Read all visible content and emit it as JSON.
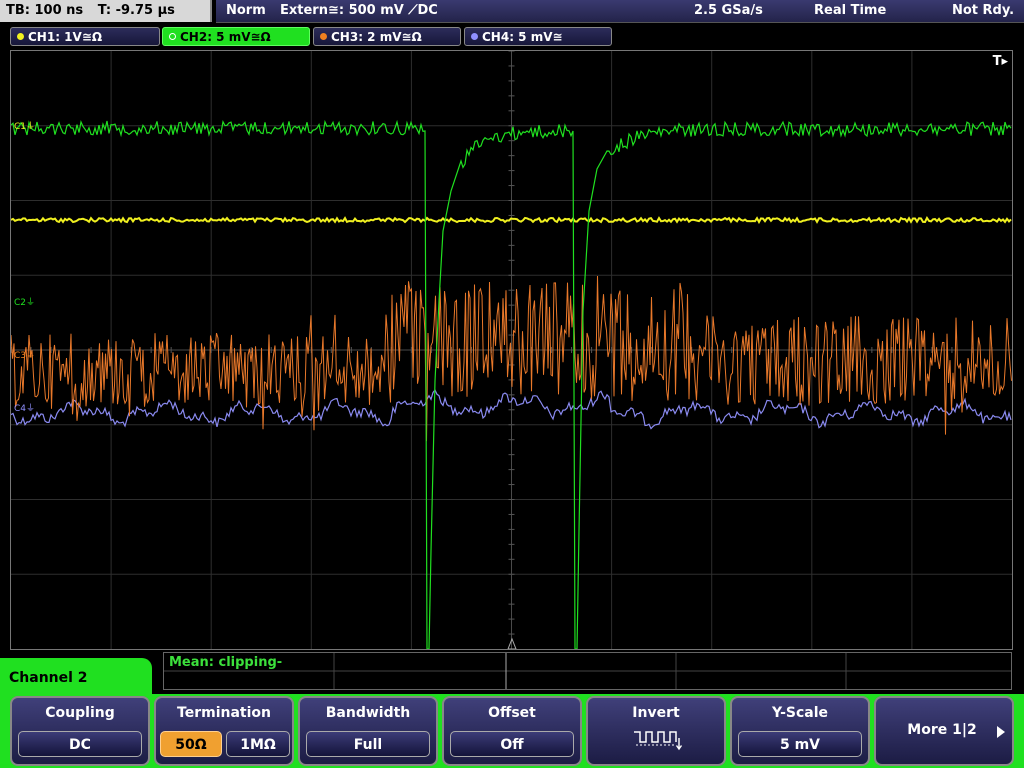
{
  "status": {
    "timebase": "TB: 100 ns",
    "trigger_time": "T: -9.75 µs",
    "trigger_mode": "Norm",
    "trigger_source": "Extern≅: 500 mV ⟋DC",
    "sample_rate": "2.5 GSa/s",
    "acq_mode": "Real Time",
    "acq_state": "Not Rdy."
  },
  "channels": [
    {
      "label": "CH1: 1V≅Ω",
      "color": "#f0f020",
      "marker": "C1"
    },
    {
      "label": "CH2: 5 mV≅Ω",
      "color": "#20e020",
      "marker": "C2",
      "active": true
    },
    {
      "label": "CH3: 2 mV≅Ω",
      "color": "#f08020",
      "marker": "C3"
    },
    {
      "label": "CH4: 5 mV≅",
      "color": "#9090ff",
      "marker": "C4"
    }
  ],
  "display": {
    "trigger_indicator": "T▸"
  },
  "measurement": {
    "text": "Mean: clipping-"
  },
  "menu": {
    "title": "Channel 2"
  },
  "softkeys": {
    "coupling": {
      "title": "Coupling",
      "value": "DC"
    },
    "termination": {
      "title": "Termination",
      "options": [
        "50Ω",
        "1MΩ"
      ],
      "selected": 0
    },
    "bandwidth": {
      "title": "Bandwidth",
      "value": "Full"
    },
    "offset": {
      "title": "Offset",
      "value": "Off"
    },
    "invert": {
      "title": "Invert",
      "icon": "invert-waveform-icon"
    },
    "yscale": {
      "title": "Y-Scale",
      "value": "5 mV"
    },
    "more": {
      "label": "More 1|2",
      "icon": "triangle-right-icon"
    }
  }
}
